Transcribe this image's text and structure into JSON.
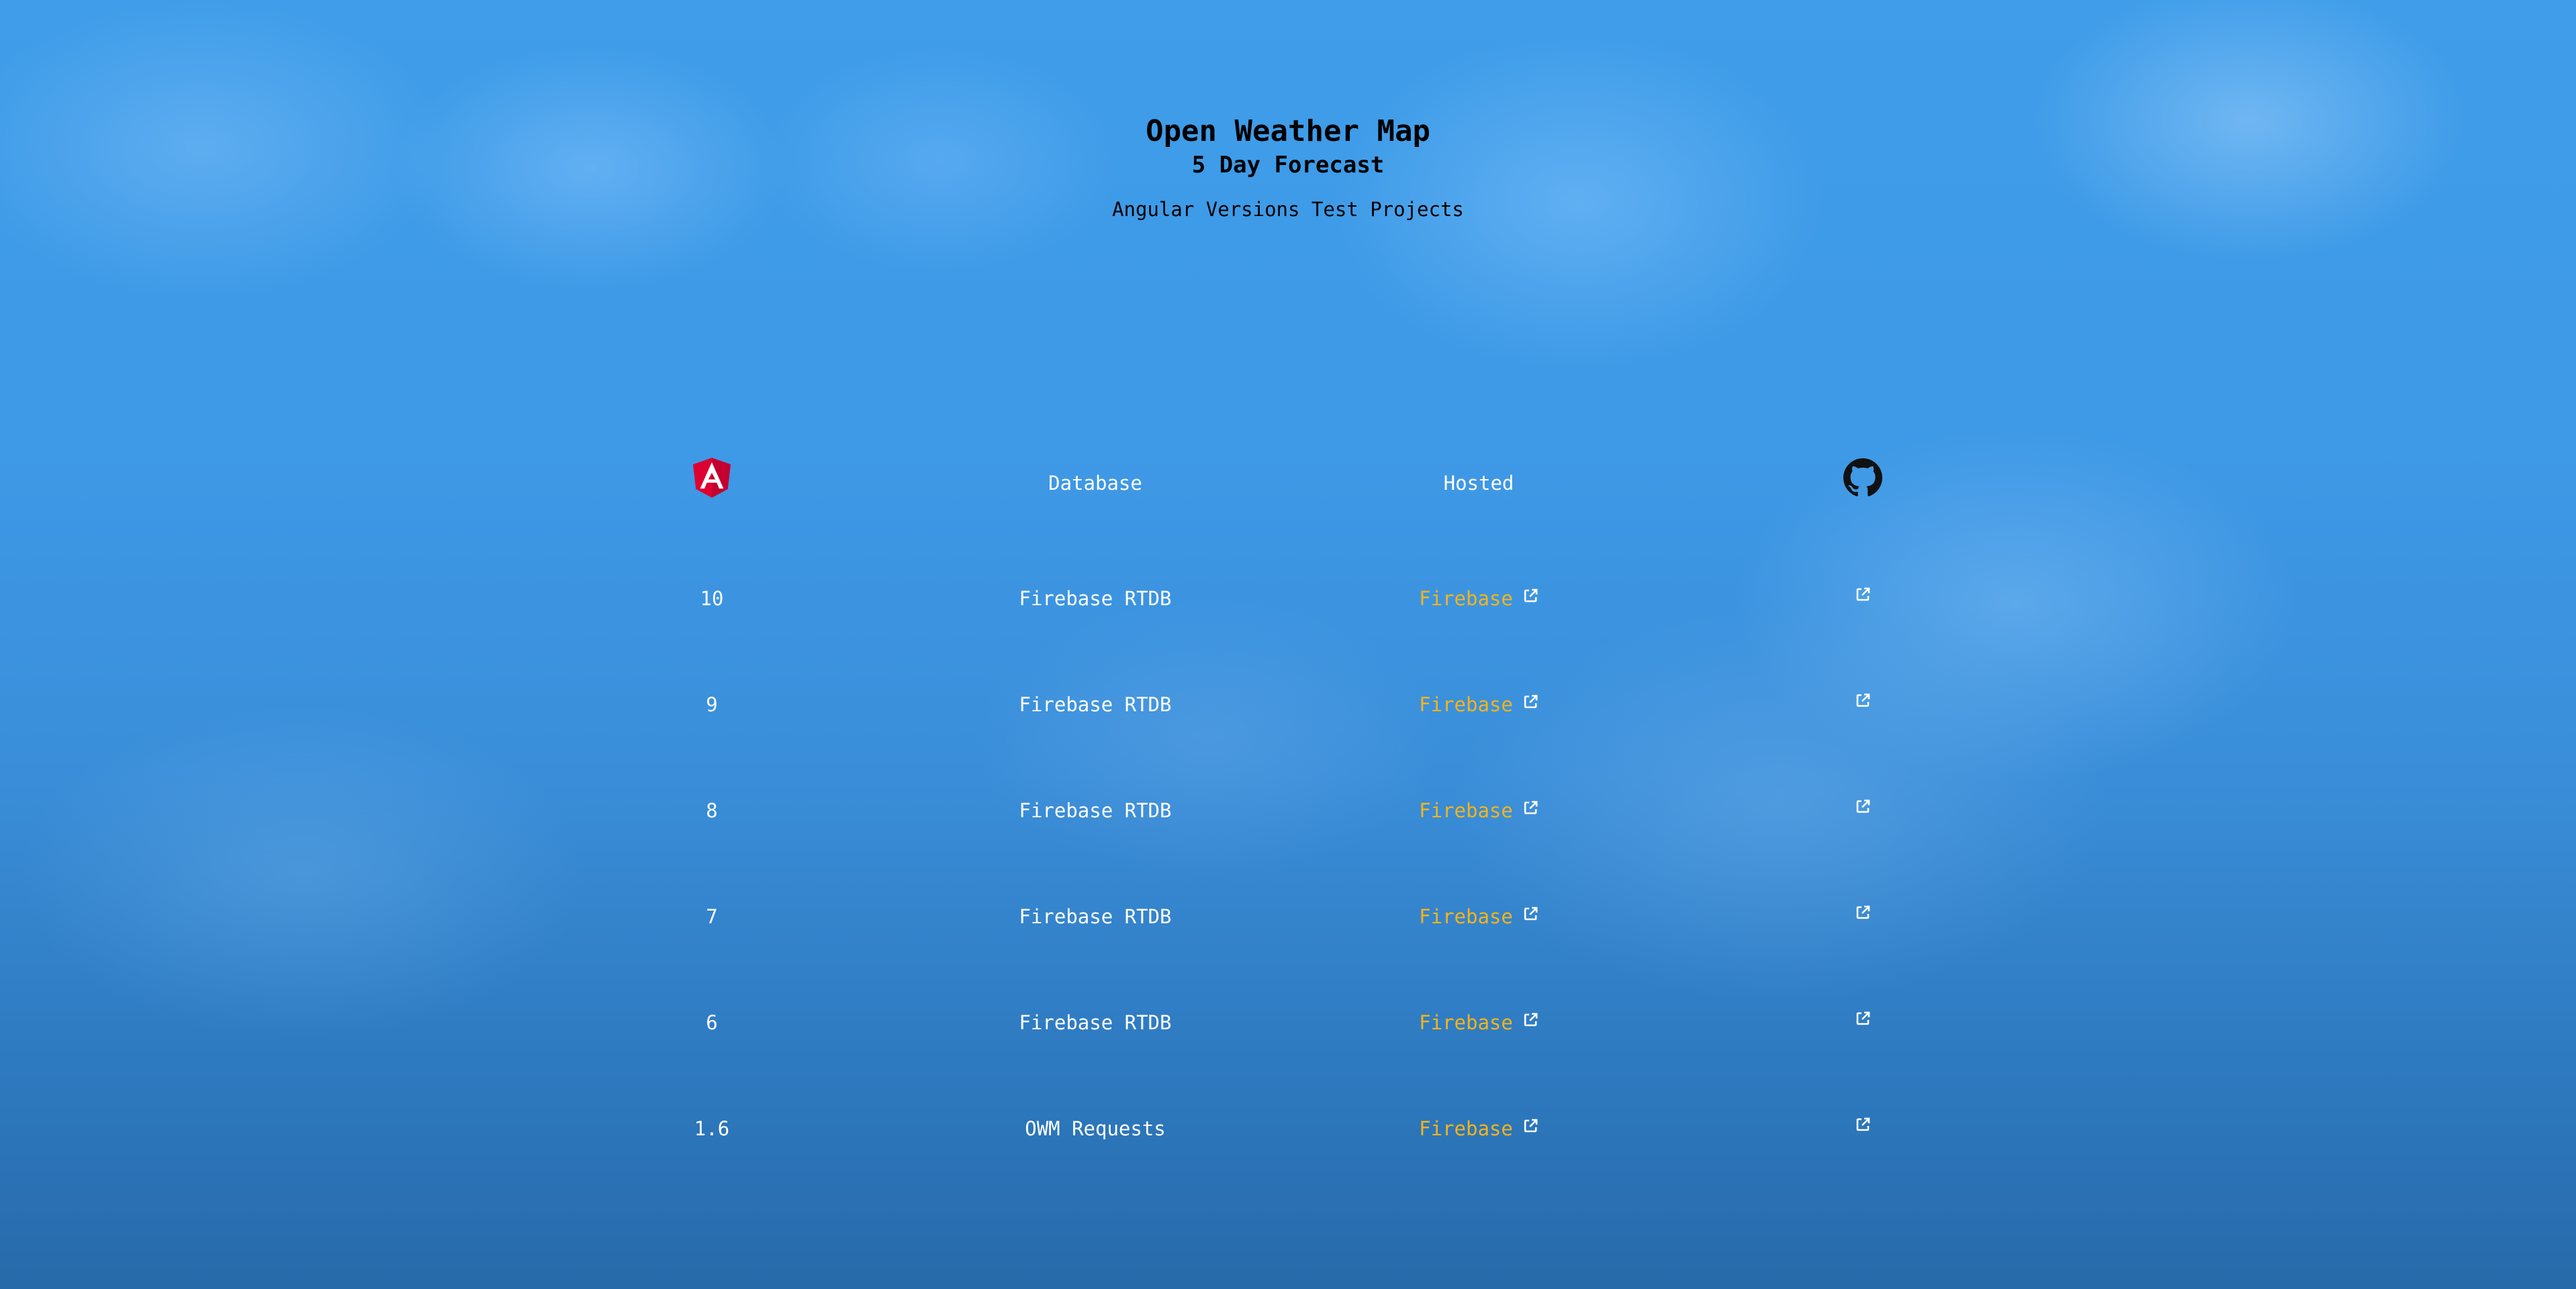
{
  "header": {
    "title": "Open Weather Map",
    "subtitle": "5 Day Forecast",
    "tagline": "Angular Versions Test Projects"
  },
  "columns": {
    "version_icon": "angular-logo-icon",
    "database": "Database",
    "hosted": "Hosted",
    "repo_icon": "github-icon"
  },
  "rows": [
    {
      "version": "10",
      "database": "Firebase RTDB",
      "hosted": "Firebase"
    },
    {
      "version": "9",
      "database": "Firebase RTDB",
      "hosted": "Firebase"
    },
    {
      "version": "8",
      "database": "Firebase RTDB",
      "hosted": "Firebase"
    },
    {
      "version": "7",
      "database": "Firebase RTDB",
      "hosted": "Firebase"
    },
    {
      "version": "6",
      "database": "Firebase RTDB",
      "hosted": "Firebase"
    },
    {
      "version": "1.6",
      "database": "OWM Requests",
      "hosted": "Firebase"
    }
  ],
  "colors": {
    "link": "#f4b41a",
    "text": "#ffffff",
    "angular_red": "#dd0031"
  }
}
